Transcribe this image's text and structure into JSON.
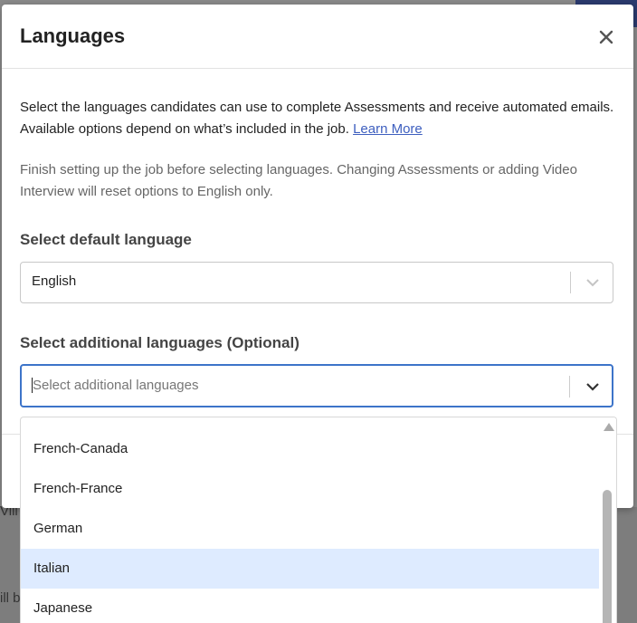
{
  "background": {
    "fragment_1": "Vill",
    "fragment_2": "ill b"
  },
  "modal": {
    "title": "Languages",
    "close_icon": "close-icon",
    "intro_text": "Select the languages candidates can use to complete Assessments and receive automated emails. Available options depend on what’s included in the job.",
    "learn_more": "Learn More",
    "note": "Finish setting up the job before selecting languages. Changing Assessments or adding Video Interview will reset options to English only.",
    "default_label": "Select default language",
    "default_value": "English",
    "additional_label": "Select additional languages (Optional)",
    "additional_placeholder": "Select additional languages"
  },
  "dropdown": {
    "options": [
      {
        "label": "French-Canada",
        "highlighted": false
      },
      {
        "label": "French-France",
        "highlighted": false
      },
      {
        "label": "German",
        "highlighted": false
      },
      {
        "label": "Italian",
        "highlighted": true
      },
      {
        "label": "Japanese",
        "highlighted": false
      }
    ]
  },
  "colors": {
    "link": "#3e5fbf",
    "focus_border": "#3d74c9",
    "highlight": "#deebff"
  }
}
